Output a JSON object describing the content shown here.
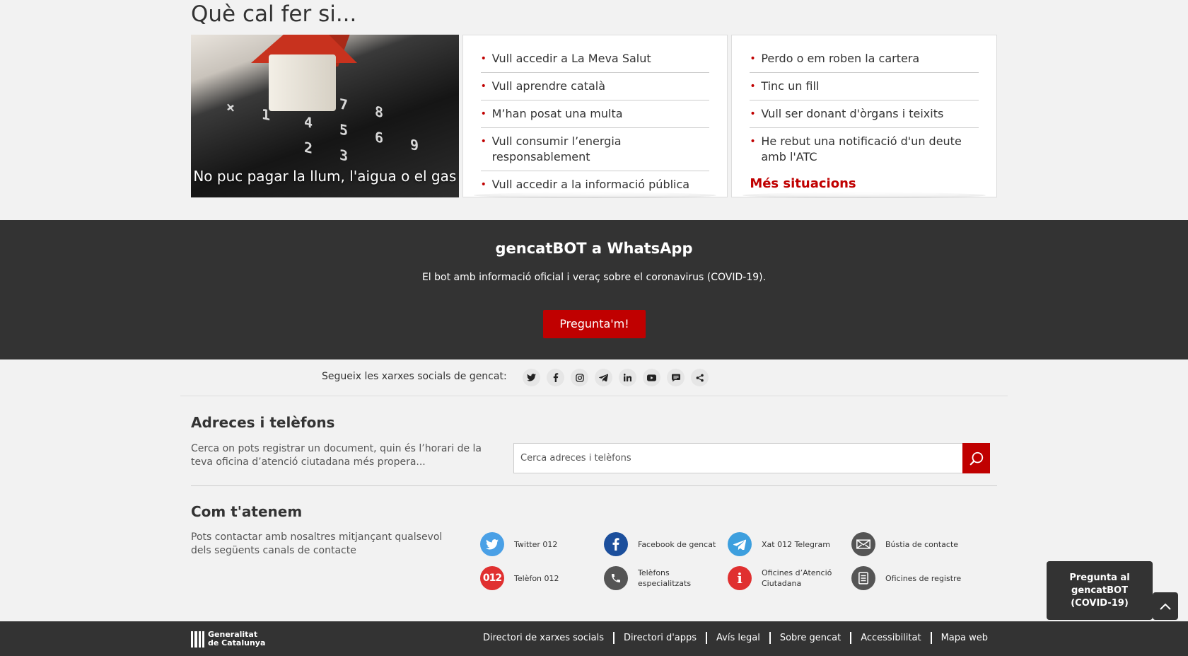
{
  "que_cal": {
    "title": "Què cal fer si...",
    "featured": {
      "caption": "No puc pagar la llum, l'aigua o el gas"
    },
    "column1": [
      "Vull accedir a La Meva Salut",
      "Vull aprendre català",
      "M’han posat una multa",
      "Vull consumir l’energia responsablement",
      "Vull accedir a la informació pública"
    ],
    "column2": [
      "Perdo o em roben la cartera",
      "Tinc un fill",
      "Vull ser donant d'òrgans i teixits",
      "He rebut una notificació d'un deute amb l'ATC"
    ],
    "more_label": "Més situacions"
  },
  "bot": {
    "title": "gencatBOT a WhatsApp",
    "description": "El bot amb informació oficial i veraç sobre el coronavirus (COVID-19).",
    "button": "Pregunta'm!"
  },
  "social": {
    "label": "Segueix les xarxes socials de gencat:",
    "icons": [
      "twitter-icon",
      "facebook-icon",
      "instagram-icon",
      "telegram-icon",
      "linkedin-icon",
      "youtube-icon",
      "chat-icon",
      "share-icon"
    ]
  },
  "adreces": {
    "title": "Adreces i telèfons",
    "description": "Cerca on pots registrar un document, quin és l’horari de la teva oficina d’atenció ciutadana més propera...",
    "search_placeholder": "Cerca adreces i telèfons"
  },
  "atenem": {
    "title": "Com t'atenem",
    "description": "Pots contactar amb nosaltres mitjançant qualsevol dels següents canals de contacte",
    "channels": [
      {
        "label": "Twitter 012",
        "icon": "twitter-icon",
        "color": "#4aa0e6"
      },
      {
        "label": "Facebook de gencat",
        "icon": "facebook-icon",
        "color": "#1c4f9c"
      },
      {
        "label": "Xat 012 Telegram",
        "icon": "telegram-icon",
        "color": "#3d9fde"
      },
      {
        "label": "Bústia de contacte",
        "icon": "mail-icon",
        "color": "#555555"
      },
      {
        "label": "Telèfon 012",
        "icon": "phone-012-icon",
        "color": "#e03030"
      },
      {
        "label": "Telèfons especialitzats",
        "icon": "phone-icon",
        "color": "#555555"
      },
      {
        "label": "Oficines d’Atenció Ciutadana",
        "icon": "info-icon",
        "color": "#e03030"
      },
      {
        "label": "Oficines de registre",
        "icon": "document-icon",
        "color": "#555555"
      }
    ]
  },
  "floating": {
    "bot_label": "Pregunta al gencatBOT (COVID-19)"
  },
  "footer": {
    "logo_line1": "Generalitat",
    "logo_line2": "de Catalunya",
    "links": [
      "Directori de xarxes socials",
      "Directori d'apps",
      "Avís legal",
      "Sobre gencat",
      "Accessibilitat",
      "Mapa web"
    ]
  },
  "colors": {
    "accent": "#c00000",
    "dark_band": "#333333",
    "background": "#f2f2f2"
  }
}
